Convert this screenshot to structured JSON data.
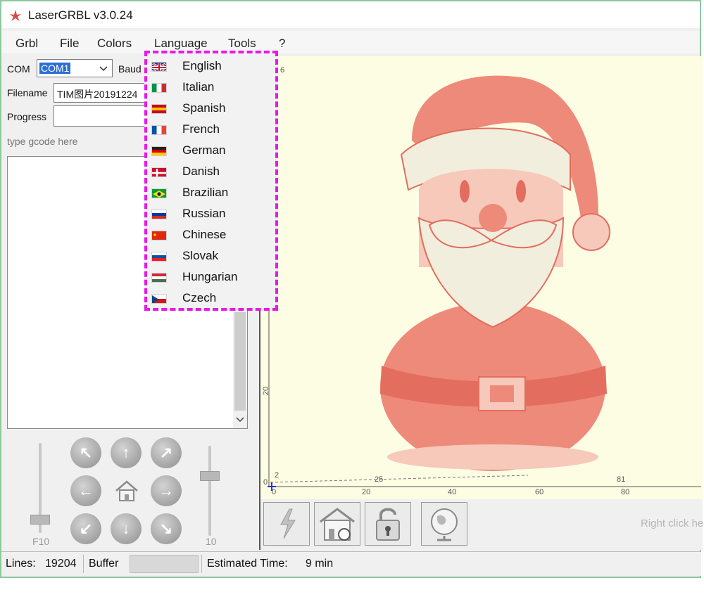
{
  "window": {
    "title": "LaserGRBL v3.0.24"
  },
  "menubar": {
    "items": [
      "Grbl",
      "File",
      "Colors",
      "Language",
      "Tools",
      "?"
    ]
  },
  "connection": {
    "com_label": "COM",
    "com_value": "COM1",
    "baud_label": "Baud",
    "filename_label": "Filename",
    "filename_value": "TIM图片20191224",
    "progress_label": "Progress",
    "gcode_placeholder": "type gcode here"
  },
  "sliders": {
    "left_value": "F10",
    "right_value": "10"
  },
  "language_menu": {
    "items": [
      {
        "label": "English",
        "flag_colors": [
          "#1f3a8a",
          "#ffffff",
          "#c8102e"
        ]
      },
      {
        "label": "Italian",
        "flag_colors": [
          "#009246",
          "#ffffff",
          "#ce2b37"
        ]
      },
      {
        "label": "Spanish",
        "flag_colors": [
          "#c60b1e",
          "#ffc400",
          "#c60b1e"
        ]
      },
      {
        "label": "French",
        "flag_colors": [
          "#0055a4",
          "#ffffff",
          "#ef4135"
        ]
      },
      {
        "label": "German",
        "flag_colors": [
          "#222222",
          "#dd0000",
          "#ffce00"
        ]
      },
      {
        "label": "Danish",
        "flag_colors": [
          "#c8102e",
          "#ffffff",
          "#c8102e"
        ]
      },
      {
        "label": "Brazilian",
        "flag_colors": [
          "#009c3b",
          "#ffdf00",
          "#002776"
        ]
      },
      {
        "label": "Russian",
        "flag_colors": [
          "#ffffff",
          "#0039a6",
          "#d52b1e"
        ]
      },
      {
        "label": "Chinese",
        "flag_colors": [
          "#de2910",
          "#de2910",
          "#de2910"
        ]
      },
      {
        "label": "Slovak",
        "flag_colors": [
          "#ffffff",
          "#0b4ea2",
          "#ee1c25"
        ]
      },
      {
        "label": "Hungarian",
        "flag_colors": [
          "#ce2939",
          "#ffffff",
          "#477050"
        ]
      },
      {
        "label": "Czech",
        "flag_colors": [
          "#ffffff",
          "#d7141a",
          "#11457e"
        ]
      }
    ]
  },
  "canvas": {
    "x_ticks": [
      "0",
      "20",
      "40",
      "60",
      "80"
    ],
    "x_marks": [
      "25",
      "81"
    ],
    "y_ticks": [
      "0",
      "20",
      "6"
    ],
    "origin_label": "2",
    "right_hint": "Right click he",
    "preview_colors": {
      "background": "#fdfde4",
      "santa": "#ee8a7a",
      "santa_light": "#f6c9bb",
      "beard": "#f2eedd"
    }
  },
  "status": {
    "lines_label": "Lines:",
    "lines_value": "19204",
    "buffer_label": "Buffer",
    "estimated_label": "Estimated Time:",
    "estimated_value": "9 min"
  },
  "colors": {
    "menu_highlight_border": "#e818e8",
    "window_border": "#8fc7a0",
    "selection": "#2a6fd6"
  }
}
